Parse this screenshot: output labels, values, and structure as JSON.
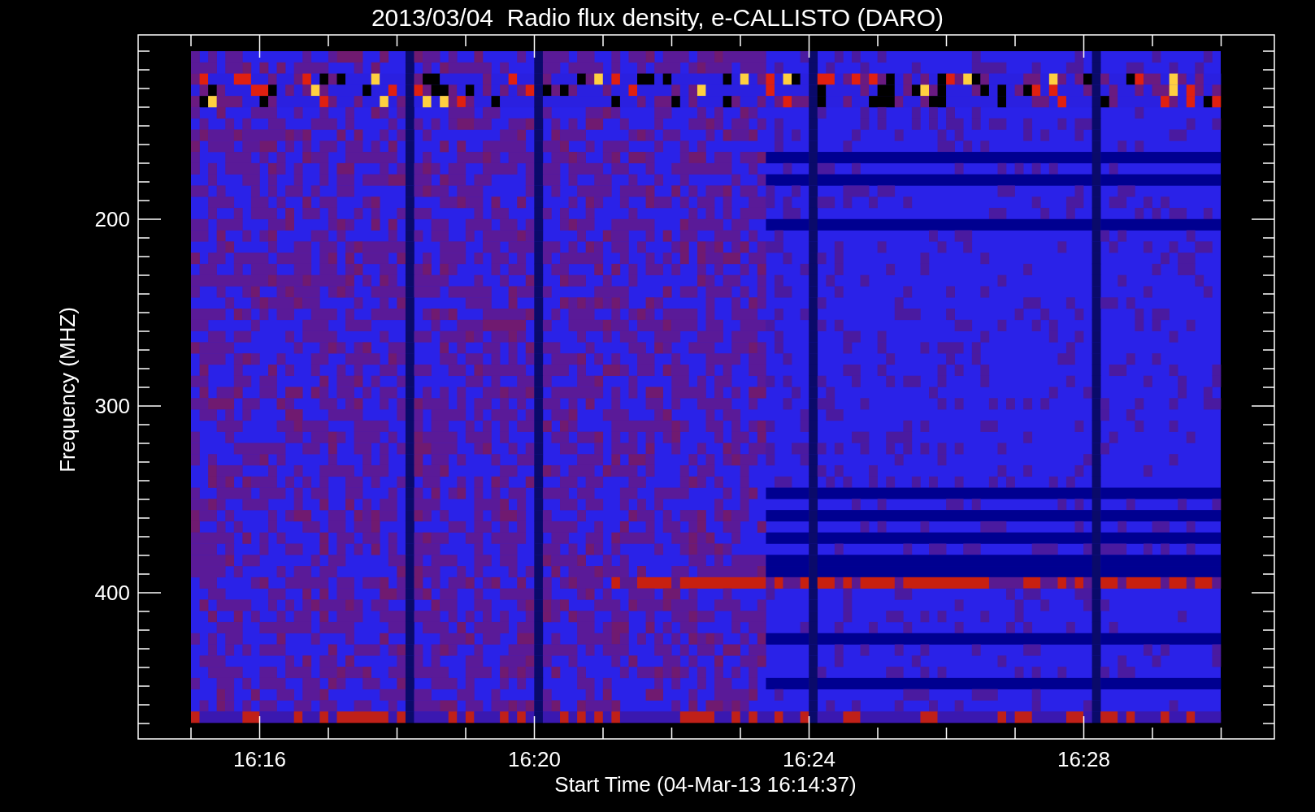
{
  "title": "2013/03/04  Radio flux density, e-CALLISTO (DARO)",
  "plot": {
    "ylabel": "Frequency (MHZ)",
    "xlabel": "Start Time (04-Mar-13 16:14:37)",
    "y_tick_labels": [
      "200",
      "300",
      "400"
    ],
    "x_tick_labels": [
      "16:16",
      "16:20",
      "16:24",
      "16:28"
    ]
  }
}
